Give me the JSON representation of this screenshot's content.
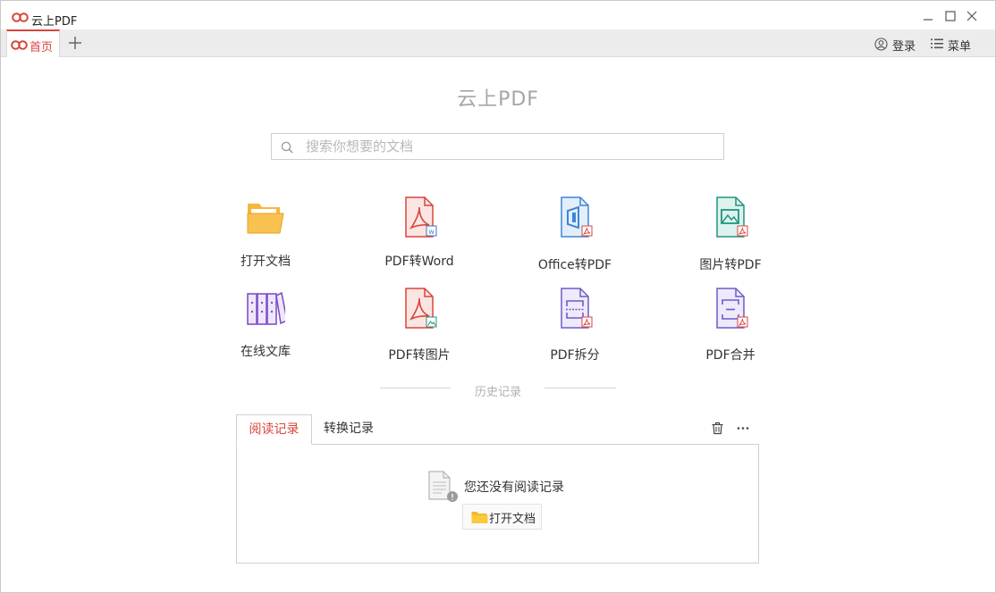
{
  "app": {
    "title": "云上PDF",
    "brand_color": "#d9453a"
  },
  "tabs": {
    "home_label": "首页"
  },
  "header": {
    "login_label": "登录",
    "menu_label": "菜单"
  },
  "main": {
    "title": "云上PDF",
    "search_placeholder": "搜索你想要的文档"
  },
  "tools": [
    {
      "label": "打开文档",
      "icon": "open-folder-icon"
    },
    {
      "label": "PDF转Word",
      "icon": "pdf-to-word-icon"
    },
    {
      "label": "Office转PDF",
      "icon": "office-to-pdf-icon"
    },
    {
      "label": "图片转PDF",
      "icon": "image-to-pdf-icon"
    },
    {
      "label": "在线文库",
      "icon": "online-library-icon"
    },
    {
      "label": "PDF转图片",
      "icon": "pdf-to-image-icon"
    },
    {
      "label": "PDF拆分",
      "icon": "pdf-split-icon"
    },
    {
      "label": "PDF合并",
      "icon": "pdf-merge-icon"
    }
  ],
  "history": {
    "section_label": "历史记录",
    "tabs": [
      "阅读记录",
      "转换记录"
    ],
    "empty_text": "您还没有阅读记录",
    "open_button_label": "打开文档"
  }
}
